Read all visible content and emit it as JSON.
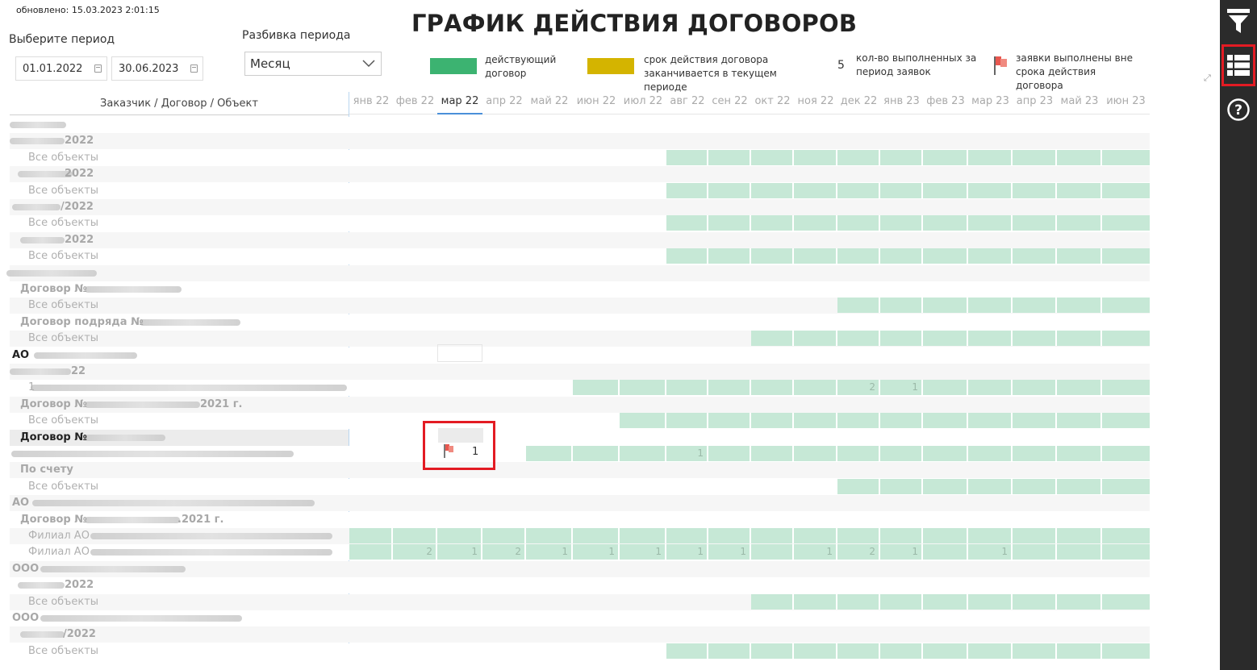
{
  "updated": "обновлено: 15.03.2023 2:01:15",
  "title": "ГРАФИК ДЕЙСТВИЯ ДОГОВОРОВ",
  "filters": {
    "period_label": "Выберите период",
    "date_from": "01.01.2022",
    "date_to": "30.06.2023",
    "breakdown_label": "Разбивка периода",
    "breakdown_value": "Месяц"
  },
  "legend": {
    "active": "действующий договор",
    "active_color": "#3cb371",
    "expiring": "срок действия договора заканчивается в текущем периоде",
    "expiring_color": "#d4b400",
    "count_number": "5",
    "count_text": "кол-во выполненных за период заявок",
    "flag_text": "заявки выполнены вне срока действия договора"
  },
  "table": {
    "header": "Заказчик / Договор / Объект",
    "months": [
      "янв 22",
      "фев 22",
      "мар 22",
      "апр 22",
      "май 22",
      "июн 22",
      "июл 22",
      "авг 22",
      "сен 22",
      "окт 22",
      "ноя 22",
      "дек 22",
      "янв 23",
      "фев 23",
      "мар 23",
      "апр 23",
      "май 23",
      "июн 23"
    ],
    "selected_month": "мар 22",
    "rows": [
      {
        "label": "",
        "start": -1,
        "vals": []
      },
      {
        "label": "2022",
        "start": -1,
        "vals": []
      },
      {
        "label": "Все объекты",
        "start": 7,
        "vals": []
      },
      {
        "label": "2022",
        "start": -1,
        "vals": []
      },
      {
        "label": "Все объекты",
        "start": 7,
        "vals": []
      },
      {
        "label": "/2022",
        "start": -1,
        "vals": []
      },
      {
        "label": "Все объекты",
        "start": 7,
        "vals": []
      },
      {
        "label": "2022",
        "start": -1,
        "vals": []
      },
      {
        "label": "Все объекты",
        "start": 7,
        "vals": []
      },
      {
        "label": "",
        "start": -1,
        "vals": []
      },
      {
        "label": "Договор №",
        "start": -1,
        "vals": []
      },
      {
        "label": "Все объекты",
        "start": 11,
        "vals": []
      },
      {
        "label": "Договор подряда №",
        "start": -1,
        "vals": []
      },
      {
        "label": "Все объекты",
        "start": 9,
        "vals": []
      },
      {
        "label": "АО",
        "start": -1,
        "vals": []
      },
      {
        "label": "22",
        "start": -1,
        "vals": []
      },
      {
        "label": "1",
        "start": 5,
        "vals": [
          {
            "i": 11,
            "v": "2"
          },
          {
            "i": 12,
            "v": "1"
          }
        ]
      },
      {
        "label": "Договор №",
        "label2": "2021 г.",
        "start": -1,
        "vals": []
      },
      {
        "label": "Все объекты",
        "start": 6,
        "vals": []
      },
      {
        "label": "Договор №",
        "start": -1,
        "vals": []
      },
      {
        "label": "",
        "start": 4,
        "vals": [
          {
            "i": 2,
            "v": "1"
          },
          {
            "i": 7,
            "v": "1"
          }
        ]
      },
      {
        "label": "По счету",
        "start": -1,
        "vals": []
      },
      {
        "label": "Все объекты",
        "start": 11,
        "vals": []
      },
      {
        "label": "АО",
        "start": -1,
        "vals": []
      },
      {
        "label": "Договор №",
        "label2": ".2021 г.",
        "start": -1,
        "vals": []
      },
      {
        "label": "Филиал АО",
        "start": 0,
        "vals": []
      },
      {
        "label": "Филиал АО",
        "start": 0,
        "vals": [
          {
            "i": 1,
            "v": "2"
          },
          {
            "i": 2,
            "v": "1"
          },
          {
            "i": 3,
            "v": "2"
          },
          {
            "i": 4,
            "v": "1"
          },
          {
            "i": 5,
            "v": "1"
          },
          {
            "i": 6,
            "v": "1"
          },
          {
            "i": 7,
            "v": "1"
          },
          {
            "i": 8,
            "v": "1"
          },
          {
            "i": 10,
            "v": "1"
          },
          {
            "i": 11,
            "v": "2"
          },
          {
            "i": 12,
            "v": "1"
          },
          {
            "i": 14,
            "v": "1"
          }
        ]
      },
      {
        "label": "ООО",
        "start": -1,
        "vals": []
      },
      {
        "label": "2022",
        "start": -1,
        "vals": []
      },
      {
        "label": "Все объекты",
        "start": 9,
        "vals": []
      },
      {
        "label": "ООО",
        "start": -1,
        "vals": []
      },
      {
        "label": "/2022",
        "start": -1,
        "vals": []
      },
      {
        "label": "Все объекты",
        "start": 7,
        "vals": []
      }
    ]
  }
}
